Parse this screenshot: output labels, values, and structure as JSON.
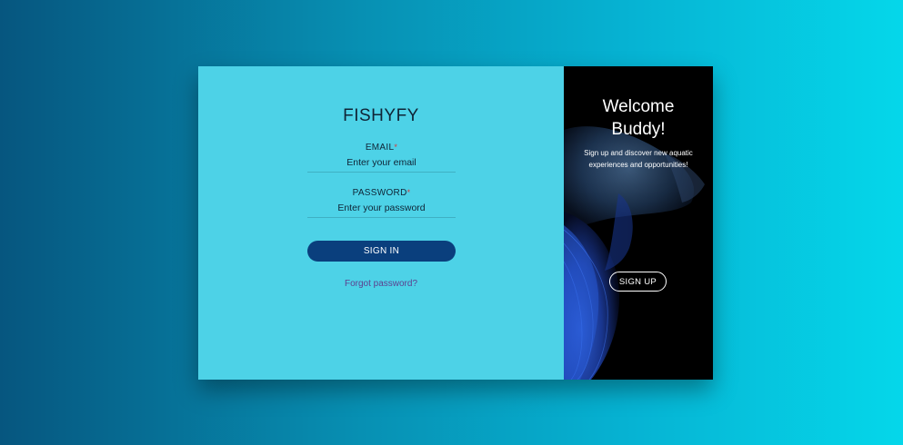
{
  "login": {
    "brand": "FISHYFY",
    "email_label": "EMAIL",
    "email_required_mark": "*",
    "email_placeholder": "Enter your email",
    "password_label": "PASSWORD",
    "password_required_mark": "*",
    "password_placeholder": "Enter your password",
    "signin_label": "SIGN IN",
    "forgot_label": "Forgot password?"
  },
  "welcome": {
    "title": "Welcome Buddy!",
    "subtitle": "Sign up and discover new aquatic experiences and opportunities!",
    "signup_label": "SIGN UP",
    "image_icon": "betta-fish-image"
  },
  "colors": {
    "login_panel_bg": "#4dd2e7",
    "signin_button": "#0a3f7d",
    "forgot_link": "#5d3f8e",
    "required_mark": "#d63b3b",
    "welcome_panel_bg": "#000000"
  }
}
